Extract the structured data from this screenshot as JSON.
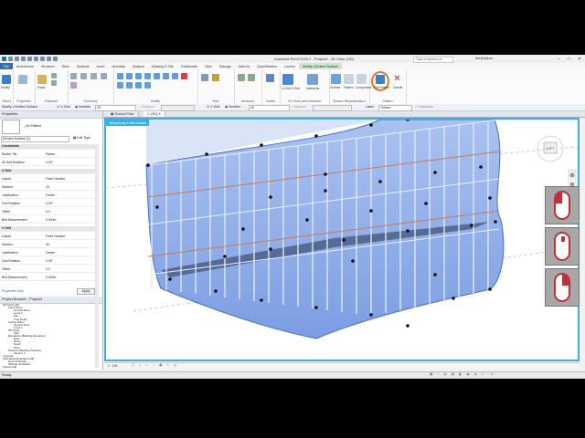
{
  "titlebar": {
    "title": "Autodesk Revit 2020.2 - Project3 - 3D View: {3D}",
    "search_placeholder": "Type a keyword or phrase",
    "user": "live@aplusc..."
  },
  "ribbon_tabs": [
    "File",
    "Architecture",
    "Structure",
    "Steel",
    "Systems",
    "Insert",
    "Annotate",
    "Analyze",
    "Massing & Site",
    "Collaborate",
    "View",
    "Manage",
    "Add-Ins",
    "Quantification",
    "Lumion",
    "Modify | Divided Surface"
  ],
  "ribbon_groups": {
    "select": "Select",
    "properties": "Properties",
    "clipboard": "Clipboard",
    "geometry": "Geometry",
    "modify": "Modify",
    "view": "View",
    "measure": "Measure",
    "create": "Create",
    "uv_grids": "UV Grids and Intersects",
    "surface_rep": "Surface Representation",
    "pattern": "Pattern"
  },
  "ribbon_labels": {
    "modify": "Modify",
    "paste": "Paste",
    "show": "Show",
    "ignore": "Ignore",
    "uv_grid": "U Grid V Grid",
    "intersects": "Intersects",
    "surface": "Surface",
    "pattern": "Pattern",
    "component": "Component",
    "edit_pattern": "Edit Pattern",
    "cancel": "Cancel"
  },
  "options_bar": {
    "context": "Modify | Divided Surface",
    "u_grid": "U Grid",
    "number_label": "Number",
    "u_number": "15",
    "distance_label": "Distance",
    "v_grid": "V Grid",
    "v_number": "40",
    "layout_label": "Layout",
    "layout_value": "Center",
    "label": "Label",
    "label_value": "<None>",
    "intersects": "Intersects"
  },
  "properties": {
    "header": "Properties",
    "type_name": "_No Pattern",
    "selector": "Divided Surface (1)",
    "edit_type": "Edit Type",
    "rows": [
      {
        "k": "Constraints",
        "v": "",
        "section": true
      },
      {
        "k": "Border Tile",
        "v": "Partial"
      },
      {
        "k": "All Grid Rotation",
        "v": "0.00°"
      },
      {
        "k": "U Grid",
        "v": "",
        "section": true
      },
      {
        "k": "Layout",
        "v": "Fixed Number"
      },
      {
        "k": "Number",
        "v": "15"
      },
      {
        "k": "Justification",
        "v": "Center"
      },
      {
        "k": "Grid Rotation",
        "v": "0.00°"
      },
      {
        "k": "Offset",
        "v": "0.0"
      },
      {
        "k": "Belt Measurement",
        "v": "0.000m"
      },
      {
        "k": "V Grid",
        "v": "",
        "section": true
      },
      {
        "k": "Layout",
        "v": "Fixed Number"
      },
      {
        "k": "Number",
        "v": "40"
      },
      {
        "k": "Justification",
        "v": "Center"
      },
      {
        "k": "Grid Rotation",
        "v": "0.00°"
      },
      {
        "k": "Offset",
        "v": "0.0"
      },
      {
        "k": "Belt Measurement",
        "v": "0.000m"
      }
    ],
    "help": "Properties help",
    "apply": "Apply"
  },
  "project_browser": {
    "header": "Project Browser - Project3",
    "items": [
      {
        "label": "[0] Views (all)",
        "depth": 0
      },
      {
        "label": "Floor Plans",
        "depth": 1
      },
      {
        "label": "Ground Floor",
        "depth": 2
      },
      {
        "label": "Level 1",
        "depth": 2
      },
      {
        "label": "Site",
        "depth": 2
      },
      {
        "label": "True North",
        "depth": 2
      },
      {
        "label": "Ceiling Plans",
        "depth": 1
      },
      {
        "label": "Ground Floor",
        "depth": 2
      },
      {
        "label": "Level 1",
        "depth": 2
      },
      {
        "label": "3D Views",
        "depth": 1
      },
      {
        "label": "{3D}",
        "depth": 2
      },
      {
        "label": "Elevations (Building Elevation)",
        "depth": 1
      },
      {
        "label": "East",
        "depth": 2
      },
      {
        "label": "North",
        "depth": 2
      },
      {
        "label": "South",
        "depth": 2
      },
      {
        "label": "West",
        "depth": 2
      },
      {
        "label": "Sections (Building Section)",
        "depth": 1
      },
      {
        "label": "Section 1",
        "depth": 2
      },
      {
        "label": "Legends",
        "depth": 0
      },
      {
        "label": "Schedules/Quantities (all)",
        "depth": 0
      },
      {
        "label": "Door Schedule",
        "depth": 1
      },
      {
        "label": "Window Schedule",
        "depth": 1
      },
      {
        "label": "Sheets (all)",
        "depth": 0
      }
    ]
  },
  "view_tabs": [
    "Ground Floor",
    "{3D}"
  ],
  "viewport": {
    "temp_label": "Temporary Hide/Isolate",
    "cube_label": "LEFT"
  },
  "viewbar": {
    "scale": "1 : 100"
  },
  "status": {
    "text": "Ready"
  },
  "colors": {
    "accent": "#36b2e6",
    "file_tab": "#2a6fb0",
    "mouse_red": "#c0303a",
    "glass": "#7fa2e6"
  }
}
